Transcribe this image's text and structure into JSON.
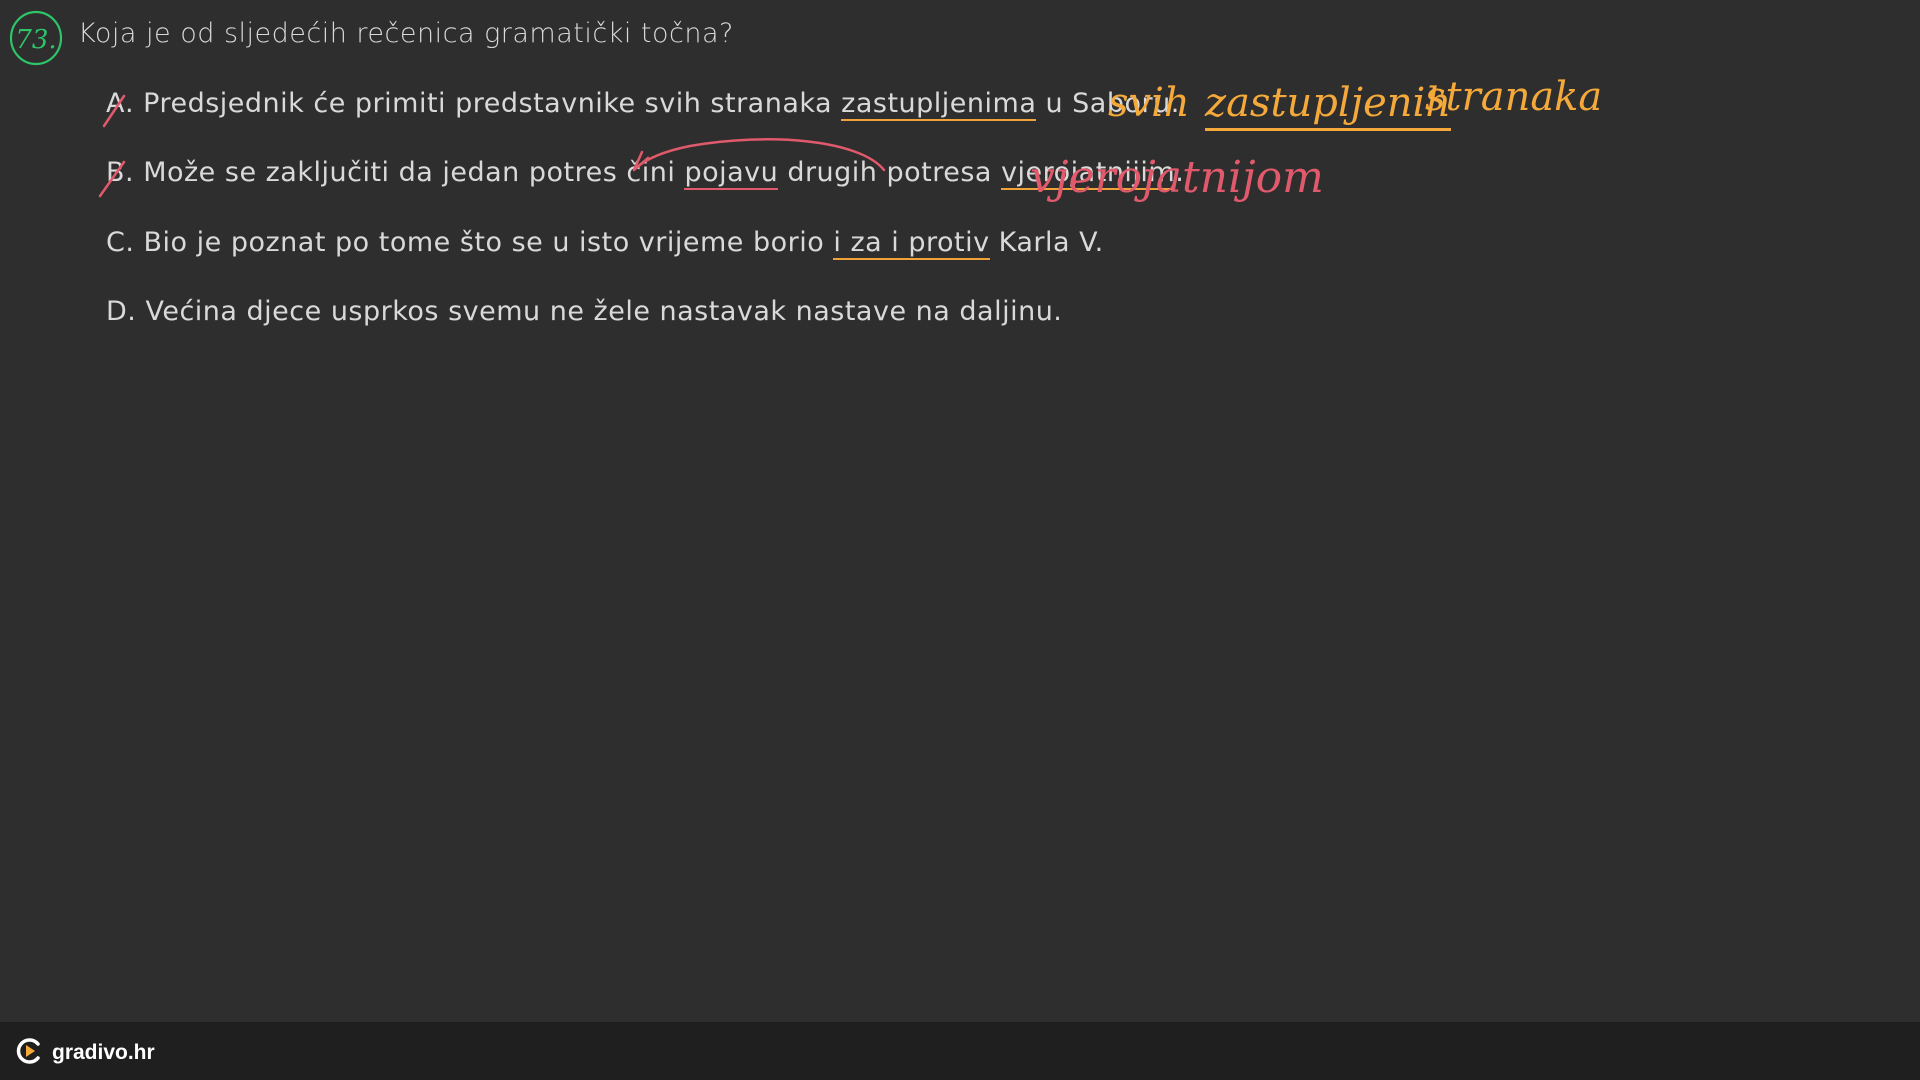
{
  "question": {
    "number": "73.",
    "text": "Koja je od sljedećih rečenica gramatički točna?"
  },
  "options": [
    {
      "letter": "A",
      "before": ". Predsjednik će primiti predstavnike svih stranaka ",
      "underlined": "zastupljenima",
      "after": " u Saboru."
    },
    {
      "letter": "B",
      "before": ". Može se zaključiti da jedan potres čini ",
      "underlined1": "pojavu",
      "middle": " drugih potresa ",
      "underlined2": "vjerojatnijim",
      "after": "."
    },
    {
      "letter": "C",
      "before": ". Bio je poznat po tome što se u isto vrijeme borio ",
      "underlined": "i za i protiv",
      "after": " Karla V."
    },
    {
      "letter": "D",
      "text": ". Većina djece usprkos svemu ne žele nastavak nastave na daljinu."
    }
  ],
  "annotations": {
    "orange_w1": "svih",
    "orange_w2": "zastupljenih",
    "orange_w3": "stranaka",
    "pink_word": "vjerojatnijom"
  },
  "footer": {
    "brand": "gradivo.hr",
    "logo_icon": "gradivo-logo-icon"
  },
  "colors": {
    "background": "#2e2e2e",
    "text": "#d9d9d9",
    "orange": "#f5a93a",
    "pink": "#e05a6c",
    "green": "#2fc36a"
  }
}
